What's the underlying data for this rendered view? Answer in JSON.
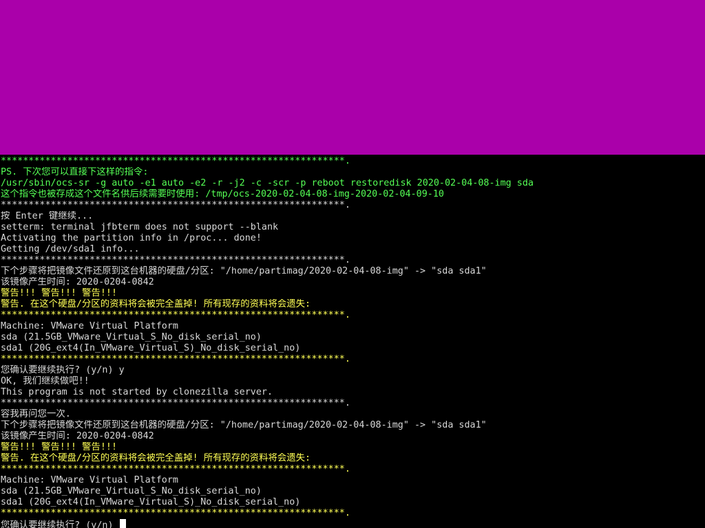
{
  "colors": {
    "band": "#aa00aa",
    "green": "#55ff55",
    "white": "#d8d8d8",
    "yellow": "#ffff55",
    "background": "#000000",
    "cursor": "#ffffff"
  },
  "terminal": {
    "lines": [
      {
        "text": "**************************************************************.",
        "color": "green"
      },
      {
        "text": "PS. 下次您可以直接下这样的指令:",
        "color": "green"
      },
      {
        "text": "/usr/sbin/ocs-sr -g auto -e1 auto -e2 -r -j2 -c -scr -p reboot restoredisk 2020-02-04-08-img sda",
        "color": "green"
      },
      {
        "text": "这个指令也被存成这个文件名供后续需要时使用: /tmp/ocs-2020-02-04-08-img-2020-02-04-09-10",
        "color": "green"
      },
      {
        "text": "**************************************************************.",
        "color": "white"
      },
      {
        "text": "按 Enter 键继续...",
        "color": "white"
      },
      {
        "text": "setterm: terminal jfbterm does not support --blank",
        "color": "white"
      },
      {
        "text": "Activating the partition info in /proc... done!",
        "color": "white"
      },
      {
        "text": "Getting /dev/sda1 info...",
        "color": "white"
      },
      {
        "text": "**************************************************************.",
        "color": "white"
      },
      {
        "text": "下个步骤将把镜像文件还原到这台机器的硬盘/分区: \"/home/partimag/2020-02-04-08-img\" -> \"sda sda1\"",
        "color": "white"
      },
      {
        "text": "该镜像产生时间: 2020-0204-0842",
        "color": "white"
      },
      {
        "text": "警告!!! 警告!!! 警告!!!",
        "color": "yellow"
      },
      {
        "text": "警告. 在这个硬盘/分区的资料将会被完全盖掉! 所有现存的资料将会遗失:",
        "color": "yellow"
      },
      {
        "text": "**************************************************************.",
        "color": "yellow"
      },
      {
        "text": "Machine: VMware Virtual Platform",
        "color": "white"
      },
      {
        "text": "sda (21.5GB_VMware_Virtual_S_No_disk_serial_no)",
        "color": "white"
      },
      {
        "text": "sda1 (20G_ext4(In_VMware_Virtual_S)_No_disk_serial_no)",
        "color": "white"
      },
      {
        "text": "**************************************************************.",
        "color": "yellow"
      },
      {
        "text": "您确认要继续执行? (y/n) y",
        "color": "white"
      },
      {
        "text": "OK, 我们继续做吧!!",
        "color": "white"
      },
      {
        "text": "This program is not started by clonezilla server.",
        "color": "white"
      },
      {
        "text": "**************************************************************.",
        "color": "white"
      },
      {
        "text": "容我再问您一次.",
        "color": "white"
      },
      {
        "text": "下个步骤将把镜像文件还原到这台机器的硬盘/分区: \"/home/partimag/2020-02-04-08-img\" -> \"sda sda1\"",
        "color": "white"
      },
      {
        "text": "该镜像产生时间: 2020-0204-0842",
        "color": "white"
      },
      {
        "text": "警告!!! 警告!!! 警告!!!",
        "color": "yellow"
      },
      {
        "text": "警告. 在这个硬盘/分区的资料将会被完全盖掉! 所有现存的资料将会遗失:",
        "color": "yellow"
      },
      {
        "text": "**************************************************************.",
        "color": "yellow"
      },
      {
        "text": "Machine: VMware Virtual Platform",
        "color": "white"
      },
      {
        "text": "sda (21.5GB_VMware_Virtual_S_No_disk_serial_no)",
        "color": "white"
      },
      {
        "text": "sda1 (20G_ext4(In_VMware_Virtual_S)_No_disk_serial_no)",
        "color": "white"
      },
      {
        "text": "**************************************************************.",
        "color": "yellow"
      },
      {
        "text": "您确认要继续执行? (y/n) ",
        "color": "white",
        "cursor": true
      }
    ]
  }
}
